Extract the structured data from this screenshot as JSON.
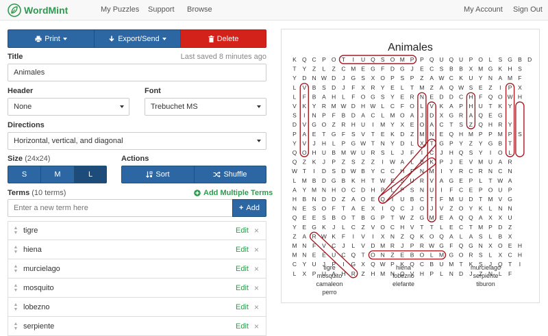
{
  "nav": {
    "brand": "WordMint",
    "links": [
      "My Puzzles",
      "Support",
      "Browse"
    ],
    "right_links": [
      "My Account",
      "Sign Out"
    ],
    "brand_color": "#2e9a4f"
  },
  "toolbar": {
    "print_label": "Print",
    "export_label": "Export/Send",
    "delete_label": "Delete"
  },
  "title_section": {
    "label": "Title",
    "last_saved": "Last saved 8 minutes ago",
    "value": "Animales"
  },
  "header_section": {
    "label": "Header",
    "value": "None"
  },
  "font_section": {
    "label": "Font",
    "value": "Trebuchet MS"
  },
  "directions_section": {
    "label": "Directions",
    "value": "Horizontal, vertical, and diagonal"
  },
  "size_section": {
    "label": "Size",
    "dims": "(24x24)",
    "options": [
      "S",
      "M",
      "L"
    ],
    "selected": "L"
  },
  "actions_section": {
    "label": "Actions",
    "sort_label": "Sort",
    "shuffle_label": "Shuffle"
  },
  "terms_section": {
    "label": "Terms",
    "count": "(10 terms)",
    "add_multiple": "Add Multiple Terms",
    "input_placeholder": "Enter a new term here",
    "add_label": "Add",
    "edit_label": "Edit",
    "terms": [
      "tigre",
      "hiena",
      "murcielago",
      "mosquito",
      "lobezno",
      "serpiente"
    ]
  },
  "puzzle": {
    "title": "Animales",
    "rows": [
      "KQCPOTIUQSOMPPQUQUPOLSGBD",
      "TYZLZCMEGFDGJECSBBXMGKHS",
      "YDNWDJGSXOPSPZAWCKUYNAMF",
      "LVBSDJFXRYELTMZAQWSEZIPX",
      "LFBAHLFOGSYERNEDDCHFQOWH",
      "VKYRMWDHWLCFOLVKAPHUTKY",
      "SINPFBDACLMOAJDXGRAQEG",
      "DVGOZRHUIMYXEOACTSZQHRY",
      "PAETGFSVTEKDZMNEQHMPPMPS",
      "YVJHLPGWTNYDLXTGPYZYGBT",
      "QOHUBMWURSLJFICJHQSYIOL",
      "QZKJPZSZZIWALBKPJEVMUAR",
      "WTIDSDWBYCCHFNMIYRCRNCN",
      "LMBDGBKHTWESURVAGEPLTWA",
      "AYMNHOCDHPLPSNUIFCEPOUP",
      "HBNDDZAOEQIUBCTFMUDTMVG",
      "NESOFTAEXIQCJOJVZOYKLNN",
      "QEESBOTBGPTWZGMEAQQAXXU",
      "YEGKJLCZVOCHVTTLECTMPDZ",
      "ZARWKFIVIXNZQKOQALASLBX",
      "MNFVCJLVDMRJPRWGFQGNXOEH",
      "MNEEUCQTONZEBOLMGORSLXCH",
      "CYUJPIGXQWPKQCBUMTKSJQTI",
      "LXPUAHRZHMNOVHPLNDJZNLF"
    ],
    "word_columns": [
      [
        "tigre",
        "mosquito",
        "camaleon",
        "perro"
      ],
      [
        "hiena",
        "lobezno",
        "elefante"
      ],
      [
        "murcielago",
        "serpiente",
        "tiburon"
      ]
    ],
    "highlight_color": "#a31c24"
  }
}
